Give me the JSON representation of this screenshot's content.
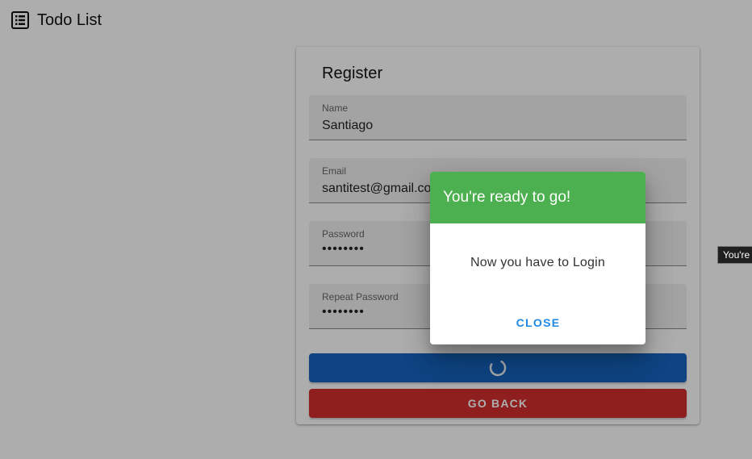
{
  "header": {
    "title": "Todo List",
    "icon": "list-icon"
  },
  "register": {
    "title": "Register",
    "fields": [
      {
        "label": "Name",
        "value": "Santiago"
      },
      {
        "label": "Email",
        "value": "santitest@gmail.com"
      },
      {
        "label": "Password",
        "value": "••••••••"
      },
      {
        "label": "Repeat Password",
        "value": "••••••••"
      }
    ],
    "submit_state": "loading",
    "go_back_label": "GO BACK"
  },
  "dialog": {
    "title": "You're ready to go!",
    "message": "Now you have to Login",
    "close_label": "CLOSE",
    "header_color": "#4caf50"
  },
  "tooltip": {
    "text": "You're ready to go!"
  },
  "colors": {
    "primary": "#1565c0",
    "danger": "#d32f2f",
    "success": "#4caf50",
    "link": "#1e88e5"
  }
}
